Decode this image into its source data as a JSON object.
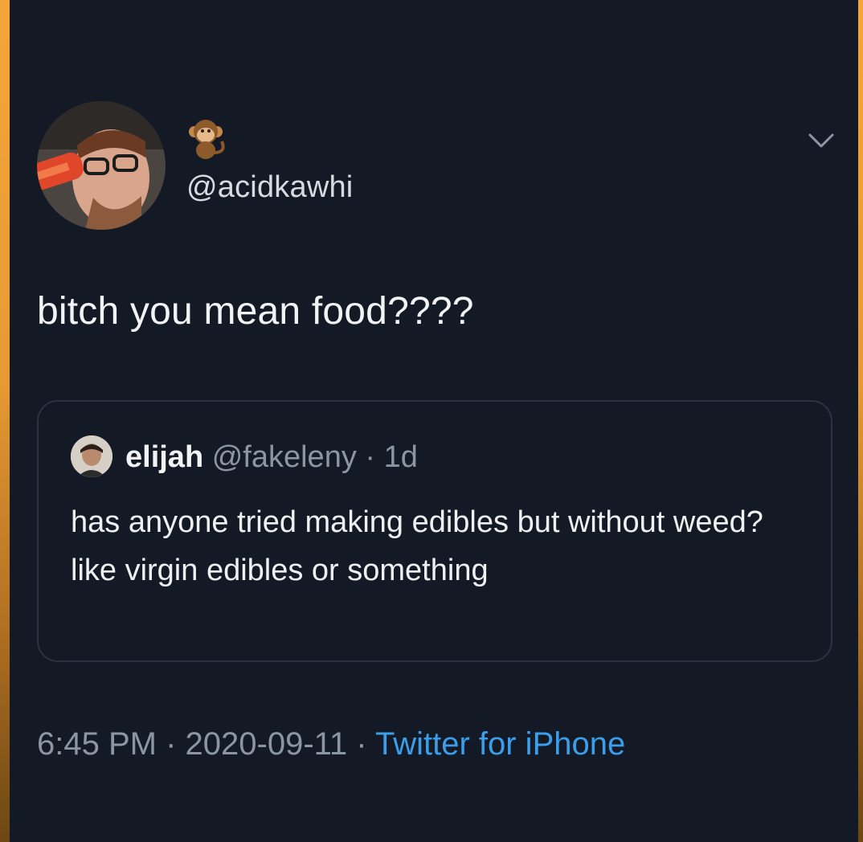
{
  "tweet": {
    "handle": "@acidkawhi",
    "text": "bitch you mean food????",
    "emoji_badge": "monkey-emoji"
  },
  "quoted_tweet": {
    "name": "elijah",
    "handle": "@fakeleny",
    "separator": " · ",
    "age": "1d",
    "text": "has anyone tried making edibles but without weed? like virgin edibles or something"
  },
  "footer": {
    "time": "6:45 PM",
    "sep1": " · ",
    "date": "2020-09-11",
    "sep2": " · ",
    "source": "Twitter for iPhone"
  },
  "colors": {
    "background": "#141a25",
    "frame": "#f4a53a",
    "link": "#3b9eea",
    "muted": "#8b96a3"
  },
  "icons": {
    "menu": "chevron-down-icon"
  }
}
